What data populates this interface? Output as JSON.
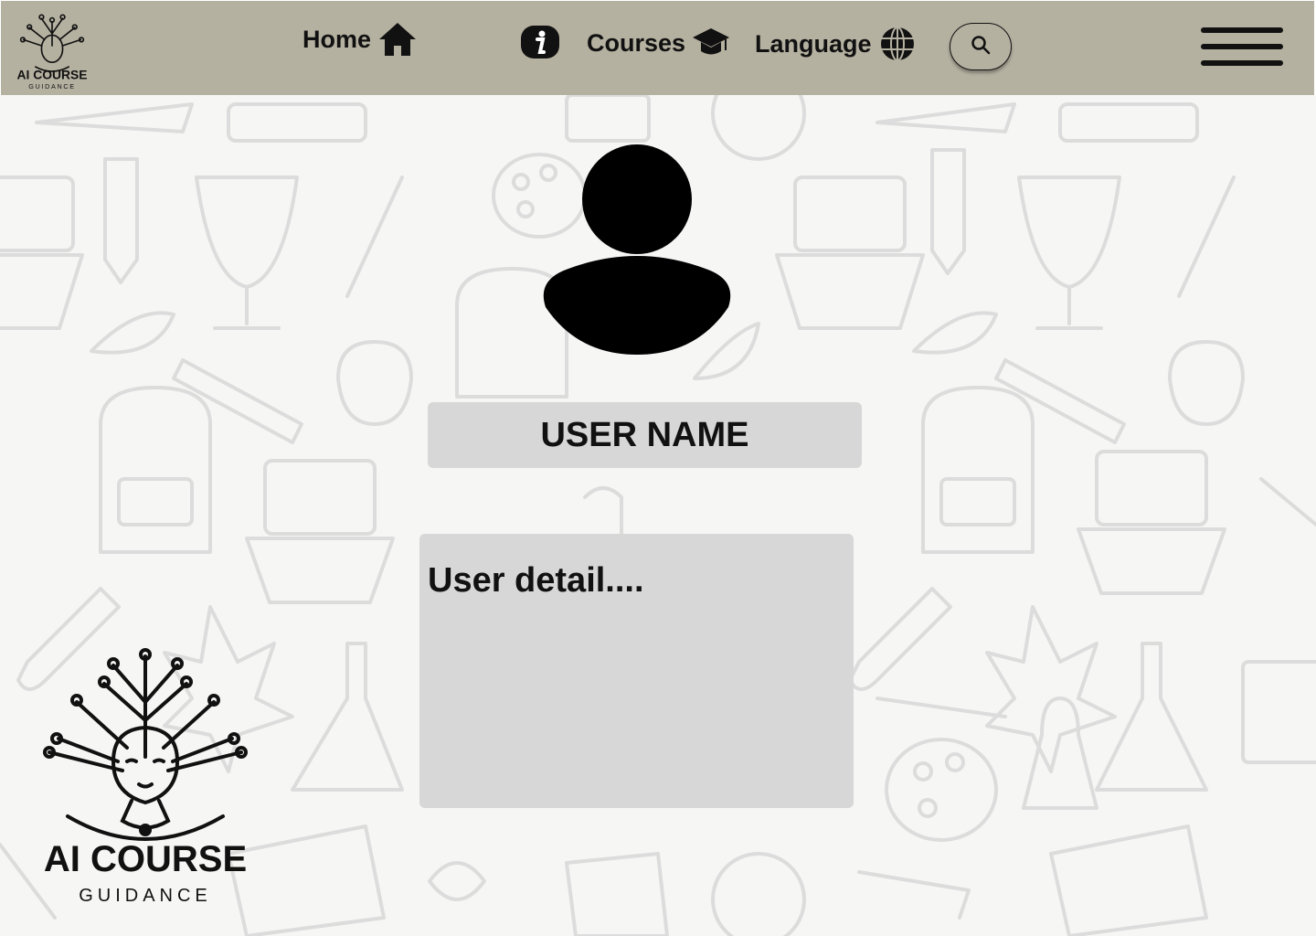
{
  "nav": {
    "home_label": "Home",
    "courses_label": "Courses",
    "language_label": "Language"
  },
  "logo": {
    "title": "AI COURSE",
    "subtitle": "GUIDANCE"
  },
  "profile": {
    "username": "USER NAME",
    "detail": "User detail...."
  },
  "colors": {
    "navbar_bg": "#b5b1a1",
    "box_bg": "#d7d7d7",
    "text": "#111111",
    "pattern_stroke": "#dcdcdc"
  },
  "icons": [
    "logo",
    "home-icon",
    "info-icon",
    "graduation-cap-icon",
    "globe-icon",
    "search-icon",
    "hamburger-menu-icon",
    "user-avatar-icon"
  ]
}
